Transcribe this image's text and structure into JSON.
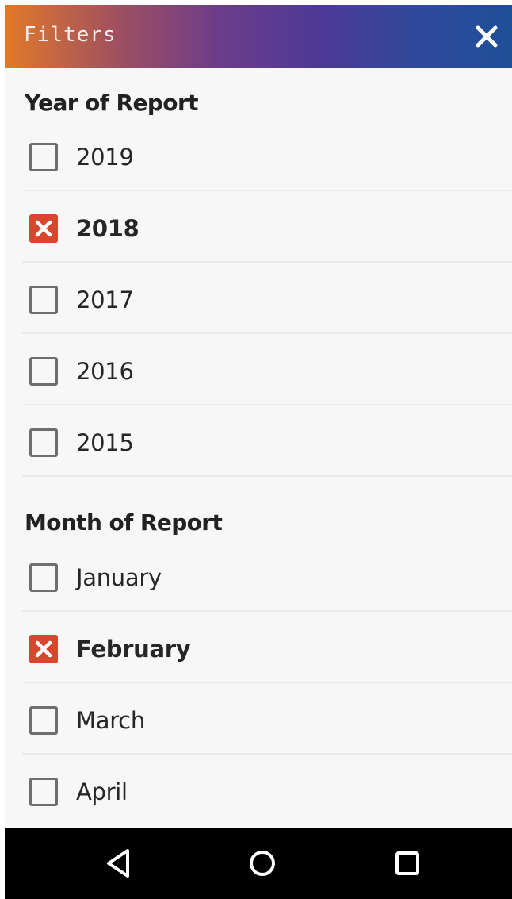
{
  "header": {
    "title": "Filters",
    "close_icon": "close-icon",
    "gradient_colors": [
      "#e2792a",
      "#6d3c8a",
      "#1f4f98"
    ]
  },
  "sections": [
    {
      "heading": "Year of Report",
      "options": [
        {
          "label": "2019",
          "checked": false
        },
        {
          "label": "2018",
          "checked": true
        },
        {
          "label": "2017",
          "checked": false
        },
        {
          "label": "2016",
          "checked": false
        },
        {
          "label": "2015",
          "checked": false
        }
      ]
    },
    {
      "heading": "Month of Report",
      "options": [
        {
          "label": "January",
          "checked": false
        },
        {
          "label": "February",
          "checked": true
        },
        {
          "label": "March",
          "checked": false
        },
        {
          "label": "April",
          "checked": false
        }
      ]
    }
  ],
  "colors": {
    "checked": "#d9462e",
    "unchecked_border": "#6e6e6e",
    "background": "#f7f7f7"
  },
  "navbar": {
    "back_icon": "back-triangle-icon",
    "home_icon": "home-circle-icon",
    "recents_icon": "recents-square-icon"
  }
}
